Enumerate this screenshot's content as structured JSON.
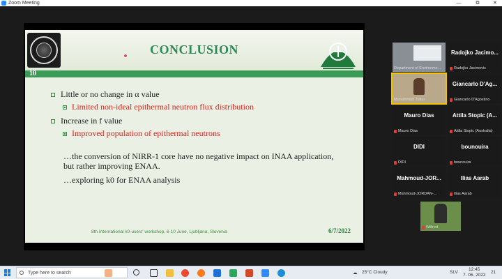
{
  "window": {
    "title": "Zoom Meeting",
    "minimize": "—",
    "restore": "⧉",
    "close": "✕"
  },
  "slide": {
    "title": "CONCLUSION",
    "number": "10",
    "bullets": [
      {
        "text": "Little or no change in α value",
        "sub": "Limited non-ideal epithermal neutron flux distribution"
      },
      {
        "text": "Increase in f value",
        "sub": "Improved population of epithermal neutrons"
      }
    ],
    "para1": "…the conversion of NIRR-1 core have no negative impact on INAA application, but rather improving ENAA.",
    "para2": "…exploring k0 for ENAA analysis",
    "footer": "8th International k0-users' workshop, 6-10 June, Ljubljana, Slovenia",
    "date": "6/7/2022"
  },
  "participants": [
    {
      "name": "",
      "label": "Department of Environme...",
      "video": true
    },
    {
      "name": "Radojko Jacimo...",
      "label": "Radojko Jacimovic"
    },
    {
      "name": "",
      "label": "Muhammad Tukur",
      "video": true,
      "active": true
    },
    {
      "name": "Giancarlo D'Ag...",
      "label": "Giancarlo D'Agostino"
    },
    {
      "name": "Mauro Dias",
      "label": "Mauro Dias"
    },
    {
      "name": "Attila Stopic (A...",
      "label": "Attila Stopic (Australia)"
    },
    {
      "name": "DIDI",
      "label": "DIDI"
    },
    {
      "name": "bounouira",
      "label": "bounouira"
    },
    {
      "name": "Mahmoud-JOR...",
      "label": "Mahmoud-JORDAN-..."
    },
    {
      "name": "Ilias Aarab",
      "label": "Ilias Aarab"
    },
    {
      "name": "",
      "label": "Wilfred",
      "video": true
    }
  ],
  "taskbar": {
    "search_placeholder": "Type here to search",
    "weather": "25°C  Cloudy",
    "lang": "SLV",
    "time": "12:45",
    "date": "7. 06. 2022",
    "notif": "21"
  }
}
